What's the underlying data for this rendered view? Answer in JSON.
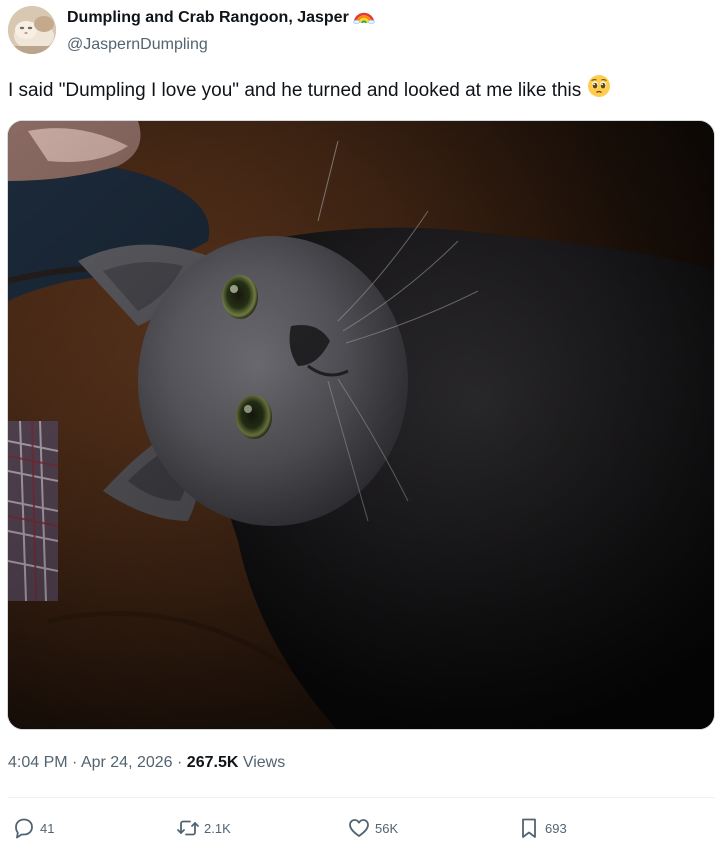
{
  "author": {
    "display_name": "Dumpling and Crab Rangoon, Jasper",
    "handle": "@JaspernDumpling",
    "name_emoji": "rainbow-icon"
  },
  "tweet": {
    "text": "I said \"Dumpling I love you\" and he turned and looked at me like this",
    "text_emoji": "pleading-face-icon"
  },
  "media": {
    "subject": "gray cat looking up at camera from brown couch"
  },
  "meta": {
    "time": "4:04 PM",
    "separator": "·",
    "date": "Apr 24, 2026",
    "views_count": "267.5K",
    "views_label": "Views"
  },
  "actions": {
    "replies": "41",
    "reposts": "2.1K",
    "likes": "56K",
    "bookmarks": "693"
  },
  "colors": {
    "text_primary": "#0f1419",
    "text_secondary": "#536471",
    "divider": "#eff3f4"
  }
}
